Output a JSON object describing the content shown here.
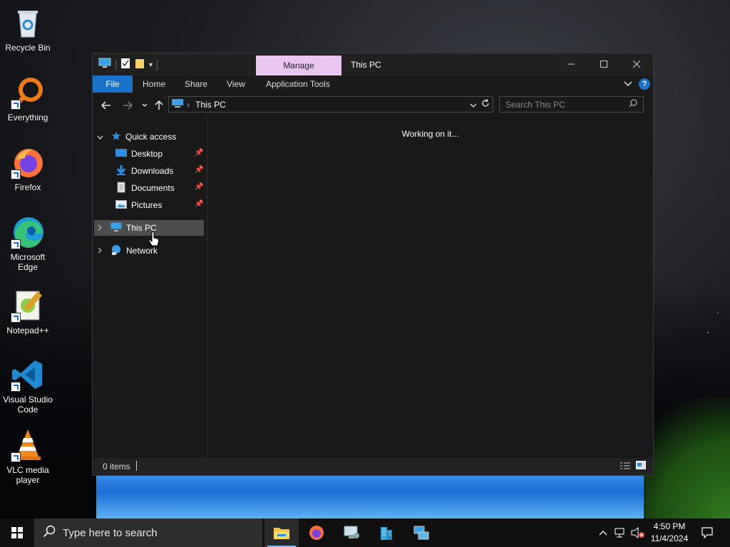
{
  "desktop": {
    "icons": [
      {
        "label": "Recycle Bin"
      },
      {
        "label": "Everything"
      },
      {
        "label": "Firefox"
      },
      {
        "label": "Microsoft Edge"
      },
      {
        "label": "Notepad++"
      },
      {
        "label": "Visual Studio Code"
      },
      {
        "label": "VLC media player"
      }
    ]
  },
  "window": {
    "title": "This PC",
    "context_tab": "Manage",
    "ribbon_tabs": [
      "File",
      "Home",
      "Share",
      "View",
      "Application Tools"
    ],
    "address": {
      "path": "This PC"
    },
    "search": {
      "placeholder": "Search This PC"
    },
    "nav_pane": {
      "quick_access": "Quick access",
      "pinned": [
        {
          "label": "Desktop",
          "icon": "desktop-folder-icon"
        },
        {
          "label": "Downloads",
          "icon": "downloads-folder-icon"
        },
        {
          "label": "Documents",
          "icon": "documents-folder-icon"
        },
        {
          "label": "Pictures",
          "icon": "pictures-folder-icon"
        }
      ],
      "this_pc": "This PC",
      "network": "Network"
    },
    "content": {
      "status_message": "Working on it..."
    },
    "statusbar": {
      "items_count": "0 items"
    }
  },
  "taskbar": {
    "search_placeholder": "Type here to search",
    "clock": {
      "time": "4:50 PM",
      "date": "11/4/2024"
    }
  },
  "colors": {
    "accent": "#1a73c8",
    "manage_tab": "#e8c6f0",
    "selection": "#4d4d4d"
  }
}
